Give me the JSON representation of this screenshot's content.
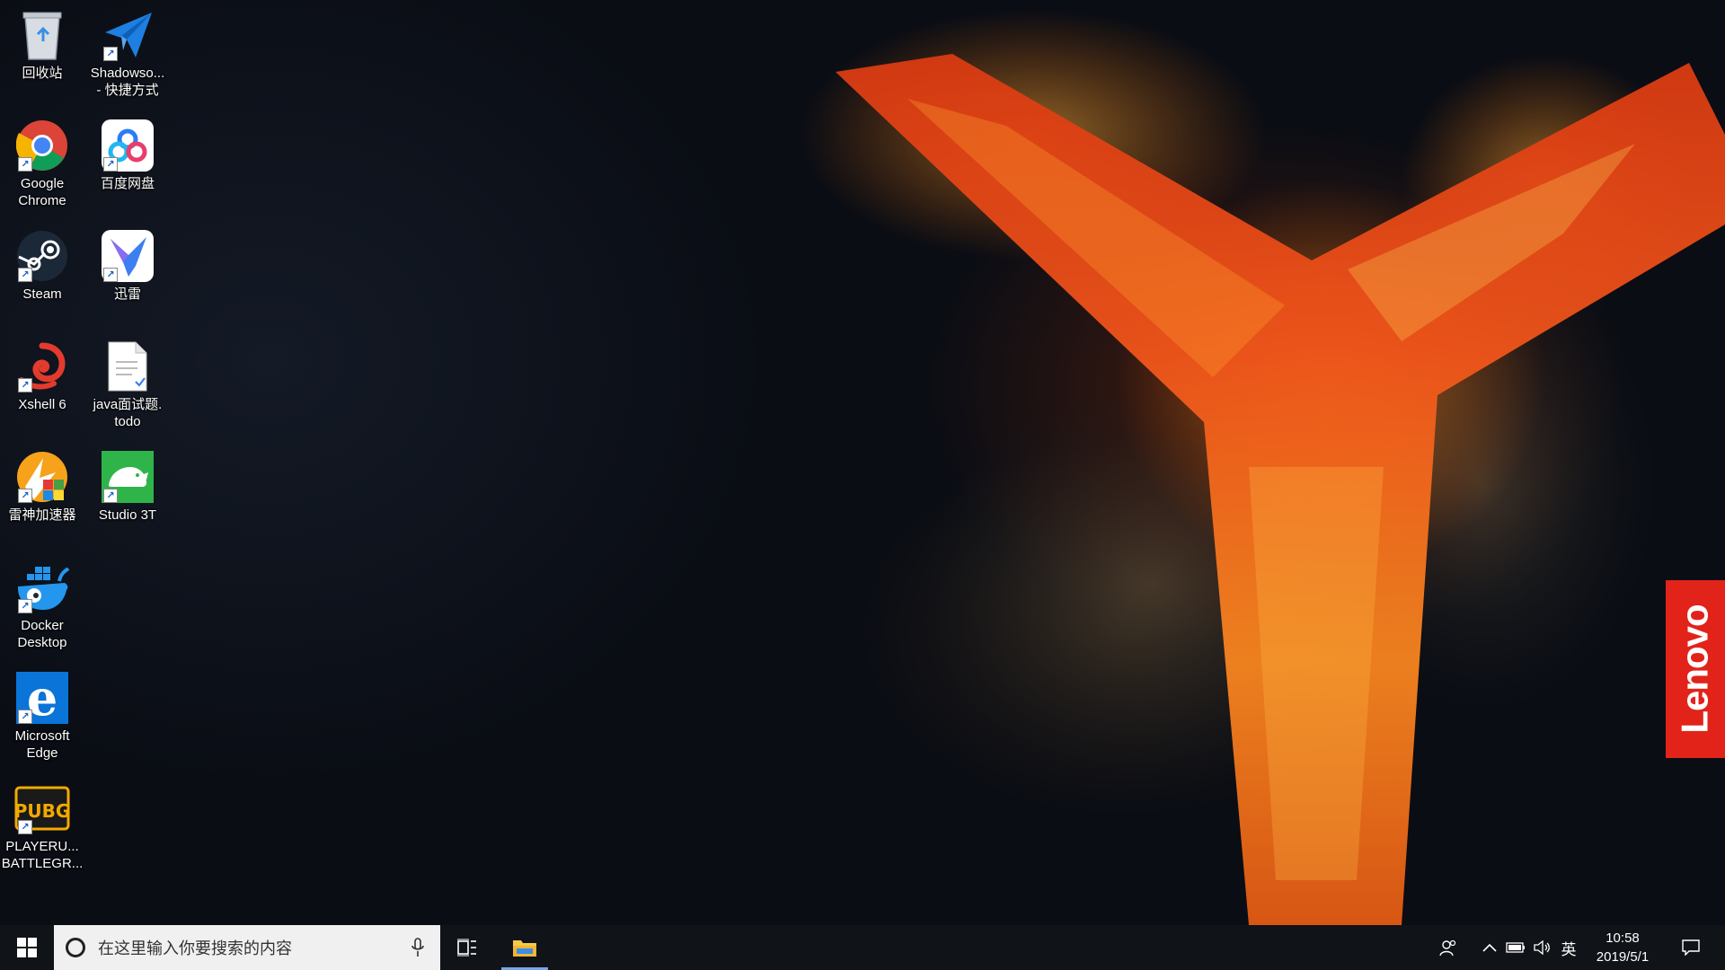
{
  "desktop": {
    "icons": [
      {
        "label": "回收站",
        "icon": "recycle-bin-icon"
      },
      {
        "label": "Shadowso...\n- 快捷方式",
        "icon": "paper-plane-icon"
      },
      {
        "label": "Google\nChrome",
        "icon": "chrome-icon"
      },
      {
        "label": "百度网盘",
        "icon": "baidu-netdisk-icon"
      },
      {
        "label": "Steam",
        "icon": "steam-icon"
      },
      {
        "label": "迅雷",
        "icon": "thunder-bird-icon"
      },
      {
        "label": "Xshell 6",
        "icon": "xshell-icon"
      },
      {
        "label": "java面试题.\ntodo",
        "icon": "document-icon"
      },
      {
        "label": "雷神加速器",
        "icon": "leishen-icon"
      },
      {
        "label": "Studio 3T",
        "icon": "studio3t-icon"
      },
      {
        "label": "Docker\nDesktop",
        "icon": "docker-whale-icon"
      },
      {
        "label": "Microsoft\nEdge",
        "icon": "edge-icon"
      },
      {
        "label": "PLAYERU...\nBATTLEGR...",
        "icon": "pubg-icon"
      }
    ],
    "wallpaper_brand": "Lenovo"
  },
  "taskbar": {
    "search_placeholder": "在这里输入你要搜索的内容",
    "ime_label": "英",
    "time": "10:58",
    "date": "2019/5/1"
  },
  "colors": {
    "taskbar_bg": "#101318",
    "search_bg": "#f0f0f0",
    "lenovo_red": "#e2231a",
    "fire_orange": "#f36a1c"
  }
}
